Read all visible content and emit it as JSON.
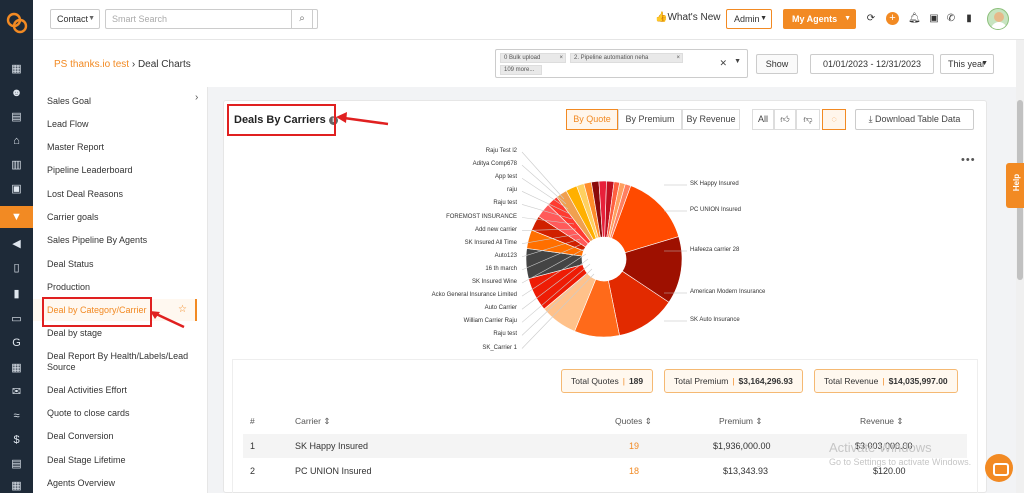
{
  "topbar": {
    "context_select": "Contact",
    "search_placeholder": "Smart Search",
    "whats_new": "What's New",
    "admin": "Admin",
    "my_agents": "My Agents"
  },
  "breadcrumb": {
    "link": "PS thanks.io test",
    "current": "Deal Charts"
  },
  "filters": {
    "tags": [
      "0 Bulk upload",
      "2. Pipeline automation neha",
      "109 more..."
    ],
    "show_button": "Show",
    "date_range": "01/01/2023 - 12/31/2023",
    "period": "This year"
  },
  "sidebar": {
    "items": [
      "Sales Goal",
      "Lead Flow",
      "Master Report",
      "Pipeline Leaderboard",
      "Lost Deal Reasons",
      "Carrier goals",
      "Sales Pipeline By Agents",
      "Deal Status",
      "Production",
      "Deal by Category/Carrier",
      "Deal by stage",
      "Deal Report By Health/Labels/Lead Source",
      "Deal Activities Effort",
      "Quote to close cards",
      "Deal Conversion",
      "Deal Stage Lifetime",
      "Agents Overview"
    ],
    "active_index": 9
  },
  "card": {
    "title": "Deals By Carriers",
    "metric_tabs": [
      "By Quote",
      "By Premium",
      "By Revenue"
    ],
    "active_metric": 0,
    "filter_tabs": [
      "All"
    ],
    "download": "Download Table Data"
  },
  "chart_data": {
    "type": "pie",
    "style": "donut",
    "legend_left": [
      "Raju Test l2",
      "Aditya Comp678",
      "App test",
      "raju",
      "Raju test",
      "FOREMOST INSURANCE",
      "Add new carrier",
      "SK Insured All Time",
      "Auto123",
      "16 th march",
      "SK Insured Wine",
      "Acko General Insurance Limited",
      "Auto Carrier",
      "William Carrier Raju",
      "Raju test",
      "SK_Carrier 1"
    ],
    "legend_right": [
      "SK Happy Insured",
      "PC UNION Insured",
      "Hafeeza carrier 28",
      "American Modern Insurance",
      "SK Auto Insurance"
    ],
    "slices": [
      {
        "label": "SK Happy Insured",
        "value": 19,
        "color": "#ff4a00"
      },
      {
        "label": "PC UNION Insured",
        "value": 18,
        "color": "#9e1000"
      },
      {
        "label": "Hafeeza carrier 28",
        "value": 16,
        "color": "#e22a00"
      },
      {
        "label": "American Modern Insurance",
        "value": 12,
        "color": "#ff6a1a"
      },
      {
        "label": "SK Auto Insurance",
        "value": 10,
        "color": "#ffc18a"
      },
      {
        "label": "SK_Carrier 1",
        "value": 9,
        "color": "#ee1c05"
      },
      {
        "label": "Raju test",
        "value": 8,
        "color": "#444444"
      },
      {
        "label": "William Carrier Raju",
        "value": 5,
        "color": "#ff6f00"
      },
      {
        "label": "Auto Carrier",
        "value": 4,
        "color": "#d02000"
      },
      {
        "label": "Acko General Insurance Limited",
        "value": 4,
        "color": "#ff5a5a"
      },
      {
        "label": "SK Insured Wine",
        "value": 3,
        "color": "#ff3a30"
      },
      {
        "label": "16 th march",
        "value": 3,
        "color": "#f0a050"
      },
      {
        "label": "Auto123",
        "value": 3,
        "color": "#ffb000"
      },
      {
        "label": "SK Insured All Time",
        "value": 2,
        "color": "#ffd060"
      },
      {
        "label": "Add new carrier",
        "value": 2,
        "color": "#ff8c2a"
      },
      {
        "label": "FOREMOST INSURANCE",
        "value": 2,
        "color": "#8a0a0a"
      },
      {
        "label": "Raju test",
        "value": 2,
        "color": "#e8203a"
      },
      {
        "label": "raju",
        "value": 2,
        "color": "#c01020"
      },
      {
        "label": "App test",
        "value": 1.5,
        "color": "#ff6040"
      },
      {
        "label": "Aditya Comp678",
        "value": 1.5,
        "color": "#ffa060"
      },
      {
        "label": "Raju Test l2",
        "value": 1.5,
        "color": "#ff8060"
      }
    ]
  },
  "totals": {
    "quotes_label": "Total Quotes",
    "quotes_value": "189",
    "premium_label": "Total Premium",
    "premium_value": "$3,164,296.93",
    "revenue_label": "Total Revenue",
    "revenue_value": "$14,035,997.00"
  },
  "table": {
    "headers": [
      "#",
      "Carrier",
      "Quotes",
      "Premium",
      "Revenue"
    ],
    "rows": [
      {
        "num": "1",
        "carrier": "SK Happy Insured",
        "quotes": "19",
        "premium": "$1,936,000.00",
        "revenue": "$3,003,000.00"
      },
      {
        "num": "2",
        "carrier": "PC UNION Insured",
        "quotes": "18",
        "premium": "$13,343.93",
        "revenue": "$120.00"
      }
    ]
  },
  "watermark": {
    "line1": "Activate Windows",
    "line2": "Go to Settings to activate Windows."
  },
  "help": "Help"
}
